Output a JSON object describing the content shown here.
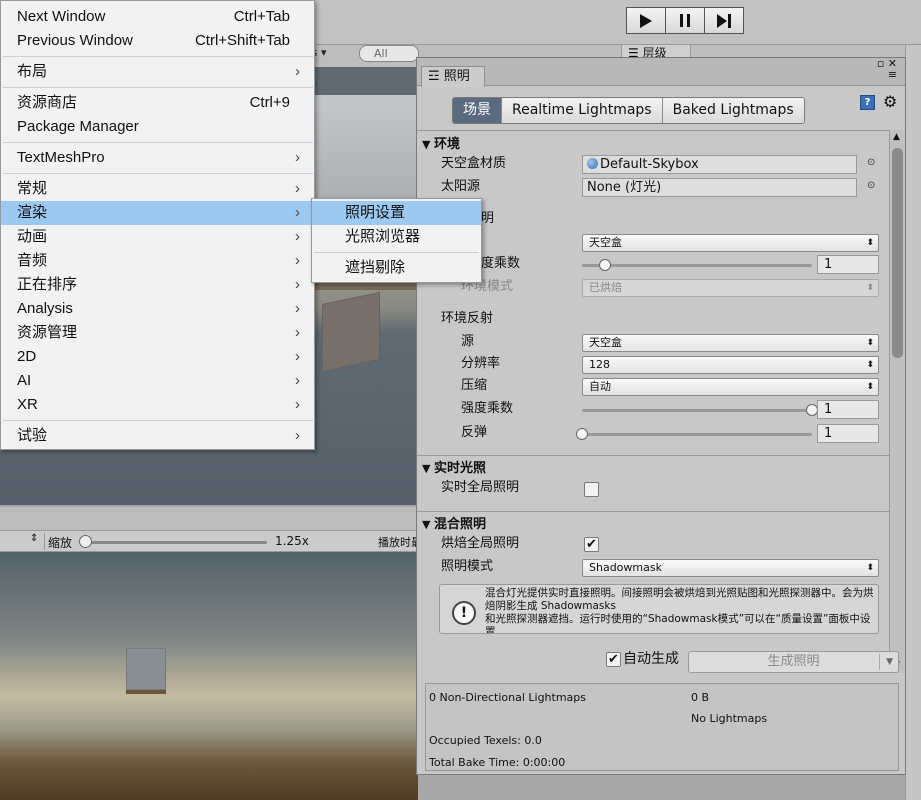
{
  "menu": {
    "items": [
      {
        "label": "Next Window",
        "shortcut": "Ctrl+Tab"
      },
      {
        "label": "Previous Window",
        "shortcut": "Ctrl+Shift+Tab"
      },
      {
        "label": "布局",
        "arrow": "›"
      },
      {
        "label": "资源商店",
        "shortcut": "Ctrl+9"
      },
      {
        "label": "Package Manager"
      },
      {
        "label": "TextMeshPro",
        "arrow": "›"
      },
      {
        "label": "常规",
        "arrow": "›"
      },
      {
        "label": "渲染",
        "arrow": "›"
      },
      {
        "label": "动画",
        "arrow": "›"
      },
      {
        "label": "音频",
        "arrow": "›"
      },
      {
        "label": "正在排序",
        "arrow": "›"
      },
      {
        "label": "Analysis",
        "arrow": "›"
      },
      {
        "label": "资源管理",
        "arrow": "›"
      },
      {
        "label": "2D",
        "arrow": "›"
      },
      {
        "label": "AI",
        "arrow": "›"
      },
      {
        "label": "XR",
        "arrow": "›"
      },
      {
        "label": "试验",
        "arrow": "›"
      }
    ],
    "highlighted": "渲染"
  },
  "submenu": {
    "items": [
      {
        "label": "照明设置"
      },
      {
        "label": "光照浏览器"
      },
      {
        "label": "遮挡剔除"
      }
    ],
    "highlighted": "照明设置"
  },
  "background": {
    "hierarchy_tab": "层级",
    "gizmos": "os ▾",
    "search_placeholder": "All",
    "game": {
      "zoom_label": "缩放",
      "zoom_value": "1.25x",
      "maximize": "播放时最",
      "zoom_fraction": 0.0
    }
  },
  "lighting": {
    "tab": "照明",
    "segments": [
      "场景",
      "Realtime Lightmaps",
      "Baked Lightmaps"
    ],
    "active_segment": "场景",
    "env": {
      "header": "环境",
      "skybox_label": "天空盒材质",
      "skybox_value": "Default-Skybox",
      "sun_label": "太阳源",
      "sun_value": "None (灯光)",
      "ambient_header_tail": "明",
      "source_value": "天空盒",
      "intensity_tail": "度乘数",
      "intensity_value": "1",
      "intensity_fraction": 0.1,
      "ambient_mode_label": "环境模式",
      "ambient_mode_value": "已烘焙",
      "reflection_header": "环境反射",
      "refl_source_label": "源",
      "refl_source_value": "天空盒",
      "resolution_label": "分辨率",
      "resolution_value": "128",
      "compression_label": "压缩",
      "compression_value": "自动",
      "refl_intensity_label": "强度乘数",
      "refl_intensity_value": "1",
      "refl_intensity_fraction": 1.0,
      "bounces_label": "反弹",
      "bounces_value": "1",
      "bounces_fraction": 0.0
    },
    "realtime": {
      "header": "实时光照",
      "gi_label": "实时全局照明",
      "gi_checked": false
    },
    "mixed": {
      "header": "混合照明",
      "baked_gi_label": "烘焙全局照明",
      "baked_gi_checked": true,
      "mode_label": "照明模式",
      "mode_value": "Shadowmask",
      "help_line1": "混合灯光提供实时直接照明。间接照明会被烘焙到光照贴图和光照探测器中。会为烘焙阴影生成 Shadowmasks",
      "help_line2": "和光照探测器遮挡。运行时使用的“Shadowmask模式”可以在“质量设置”面板中设置。"
    },
    "auto_generate_label": "自动生成",
    "auto_generate_checked": true,
    "generate_button": "生成照明",
    "stats": {
      "lightmaps": "0 Non-Directional Lightmaps",
      "size": "0 B",
      "no_lightmaps": "No Lightmaps",
      "occupied": "Occupied Texels: 0.0",
      "bake_time": "Total Bake Time: 0:00:00"
    }
  },
  "colors": {
    "menu_highlight": "#9bc9f2",
    "active_segment": "#5a6b80"
  }
}
